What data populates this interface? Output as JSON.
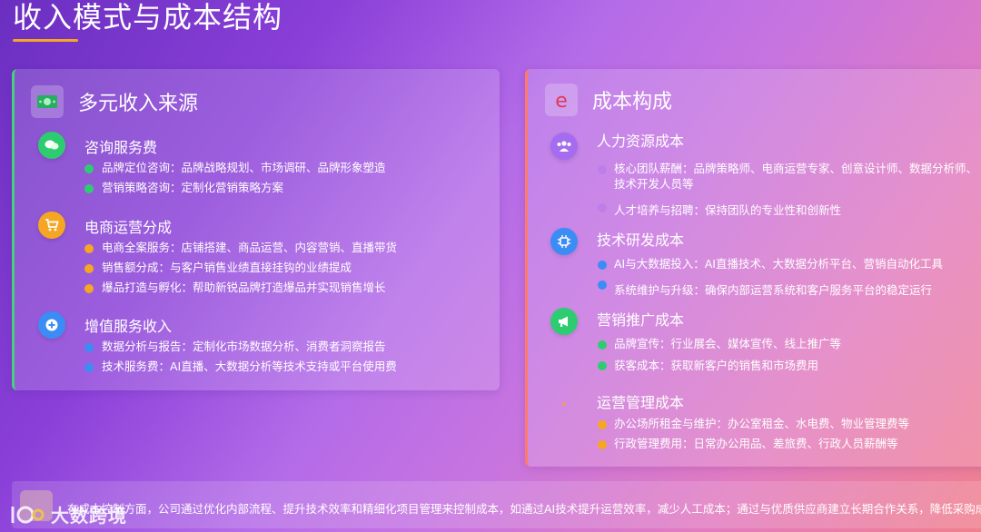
{
  "page": {
    "title": "收入模式与成本结构"
  },
  "revenue": {
    "title": "多元收入来源",
    "sections": [
      {
        "title": "咨询服务费",
        "color": "#2ecc71",
        "items": [
          "品牌定位咨询：品牌战略规划、市场调研、品牌形象塑造",
          "营销策略咨询：定制化营销策略方案"
        ]
      },
      {
        "title": "电商运营分成",
        "color": "#f5a623",
        "items": [
          "电商全案服务：店铺搭建、商品运营、内容营销、直播带货",
          "销售额分成：与客户销售业绩直接挂钩的业绩提成",
          "爆品打造与孵化：帮助新锐品牌打造爆品并实现销售增长"
        ]
      },
      {
        "title": "增值服务收入",
        "color": "#3b8cf5",
        "items": [
          "数据分析与报告：定制化市场数据分析、消费者洞察报告",
          "技术服务费：AI直播、大数据分析等技术支持或平台使用费"
        ]
      }
    ]
  },
  "cost": {
    "title": "成本构成",
    "sections": [
      {
        "title": "人力资源成本",
        "color": "#a56cf0",
        "items": [
          "核心团队薪酬：品牌策略师、电商运营专家、创意设计师、数据分析师、技术开发人员等",
          "人才培养与招聘：保持团队的专业性和创新性"
        ]
      },
      {
        "title": "技术研发成本",
        "color": "#3b8cf5",
        "items": [
          "AI与大数据投入：AI直播技术、大数据分析平台、营销自动化工具",
          "系统维护与升级：确保内部运营系统和客户服务平台的稳定运行"
        ]
      },
      {
        "title": "营销推广成本",
        "color": "#2ecc71",
        "items": [
          "品牌宣传：行业展会、媒体宣传、线上推广等",
          "获客成本：获取新客户的销售和市场费用"
        ]
      },
      {
        "title": "运营管理成本",
        "color": "#f5a623",
        "items": [
          "办公场所租金与维护：办公室租金、水电费、物业管理费等",
          "行政管理费用：日常办公用品、差旅费、行政人员薪酬等"
        ]
      }
    ]
  },
  "footer": {
    "text": "在成本控制方面，公司通过优化内部流程、提升技术效率和精细化项目管理来控制成本，如通过AI技术提升运营效率，减少人工成本；通过与优质供应商建立长期合作关系，降低采购成本。"
  },
  "watermark": {
    "text": "大数跨境"
  }
}
